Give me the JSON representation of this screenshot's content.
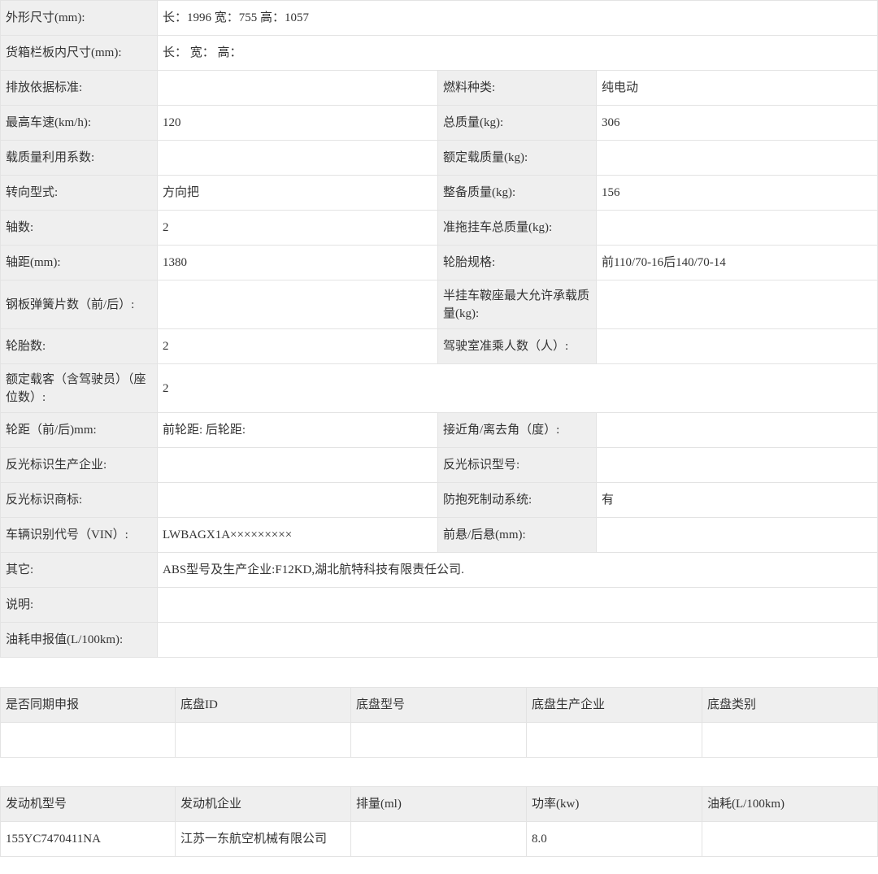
{
  "spec": {
    "dimensions_label": "外形尺寸(mm):",
    "dimensions_value": "长：1996 宽：755 高：1057",
    "cargo_box_label": "货箱栏板内尺寸(mm):",
    "cargo_box_value": "长： 宽： 高：",
    "emission_std_label": "排放依据标准:",
    "emission_std_value": "",
    "fuel_type_label": "燃料种类:",
    "fuel_type_value": "纯电动",
    "max_speed_label": "最高车速(km/h):",
    "max_speed_value": "120",
    "total_mass_label": "总质量(kg):",
    "total_mass_value": "306",
    "load_factor_label": "载质量利用系数:",
    "load_factor_value": "",
    "rated_load_label": "额定载质量(kg):",
    "rated_load_value": "",
    "steering_label": "转向型式:",
    "steering_value": "方向把",
    "curb_mass_label": "整备质量(kg):",
    "curb_mass_value": "156",
    "axles_label": "轴数:",
    "axles_value": "2",
    "trailer_mass_label": "准拖挂车总质量(kg):",
    "trailer_mass_value": "",
    "wheelbase_label": "轴距(mm):",
    "wheelbase_value": "1380",
    "tire_spec_label": "轮胎规格:",
    "tire_spec_value": "前110/70-16后140/70-14",
    "leaf_spring_label": "钢板弹簧片数（前/后）:",
    "leaf_spring_value": "",
    "saddle_load_label": "半挂车鞍座最大允许承载质量(kg):",
    "saddle_load_value": "",
    "tire_count_label": "轮胎数:",
    "tire_count_value": "2",
    "cab_seats_label": "驾驶室准乘人数（人）:",
    "cab_seats_value": "",
    "passengers_label": "额定载客（含驾驶员）（座位数）:",
    "passengers_value": "2",
    "track_label": "轮距（前/后)mm:",
    "track_value": "前轮距: 后轮距:",
    "angle_label": "接近角/离去角（度）:",
    "angle_value": "",
    "reflector_maker_label": "反光标识生产企业:",
    "reflector_maker_value": "",
    "reflector_model_label": "反光标识型号:",
    "reflector_model_value": "",
    "reflector_brand_label": "反光标识商标:",
    "reflector_brand_value": "",
    "abs_label": "防抱死制动系统:",
    "abs_value": "有",
    "vin_label": "车辆识别代号（VIN）:",
    "vin_value": "LWBAGX1A×××××××××",
    "overhang_label": "前悬/后悬(mm):",
    "overhang_value": "",
    "other_label": "其它:",
    "other_value": "ABS型号及生产企业:F12KD,湖北航特科技有限责任公司.",
    "notes_label": "说明:",
    "notes_value": "",
    "fuel_report_label": "油耗申报值(L/100km):",
    "fuel_report_value": ""
  },
  "chassis": {
    "headers": [
      "是否同期申报",
      "底盘ID",
      "底盘型号",
      "底盘生产企业",
      "底盘类别"
    ],
    "row": [
      "",
      "",
      "",
      "",
      ""
    ]
  },
  "engine": {
    "headers": [
      "发动机型号",
      "发动机企业",
      "排量(ml)",
      "功率(kw)",
      "油耗(L/100km)"
    ],
    "row": [
      "155YC7470411NA",
      "江苏一东航空机械有限公司",
      "",
      "8.0",
      ""
    ]
  }
}
